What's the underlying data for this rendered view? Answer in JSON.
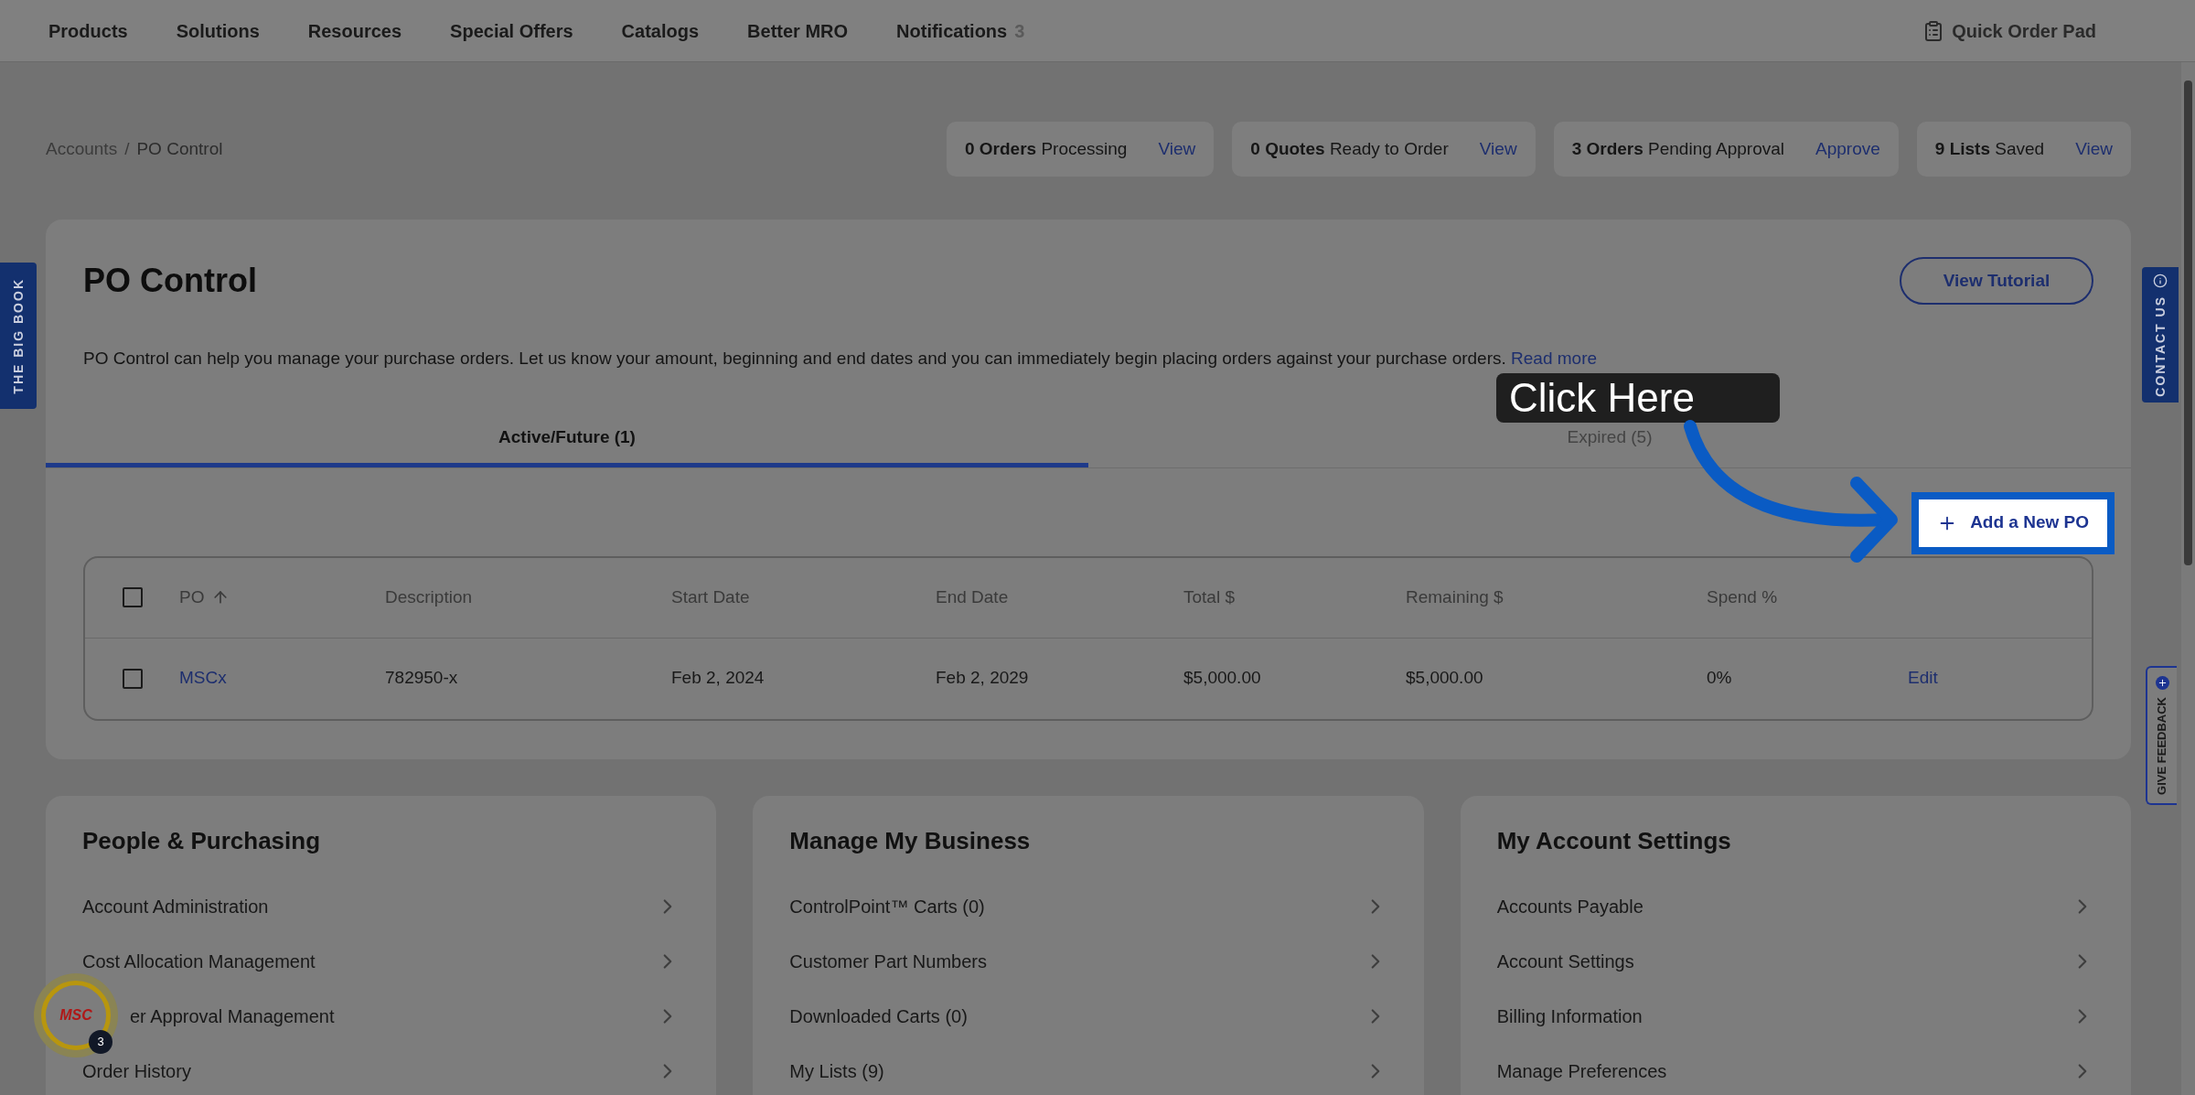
{
  "nav": {
    "items": [
      {
        "label": "Products"
      },
      {
        "label": "Solutions"
      },
      {
        "label": "Resources"
      },
      {
        "label": "Special Offers"
      },
      {
        "label": "Catalogs"
      },
      {
        "label": "Better MRO"
      },
      {
        "label": "Notifications",
        "count": "3"
      }
    ],
    "quick_order": "Quick Order Pad"
  },
  "breadcrumb": {
    "items": [
      "Accounts",
      "PO Control"
    ],
    "separator": "/"
  },
  "stats": [
    {
      "count": "0 Orders",
      "label": "Processing",
      "action": "View"
    },
    {
      "count": "0 Quotes",
      "label": "Ready to Order",
      "action": "View"
    },
    {
      "count": "3 Orders",
      "label": "Pending Approval",
      "action": "Approve"
    },
    {
      "count": "9 Lists",
      "label": "Saved",
      "action": "View"
    }
  ],
  "side_tabs": {
    "left": "THE BIG BOOK",
    "contact": "CONTACT US",
    "feedback": "GIVE FEEDBACK"
  },
  "po": {
    "title": "PO Control",
    "button": "View Tutorial",
    "description": "PO Control can help you manage your purchase orders. Let us know your amount, beginning and end dates and you can immediately begin placing orders against your purchase orders.",
    "read_more": "Read more",
    "tabs": [
      {
        "label": "Active/Future (1)",
        "selected": true
      },
      {
        "label": "Expired (5)",
        "selected": false
      }
    ],
    "add_button": "Add a New PO",
    "table": {
      "select_all_checked": false,
      "columns": [
        "PO",
        "Description",
        "Start Date",
        "End Date",
        "Total $",
        "Remaining $",
        "Spend %"
      ],
      "rows": [
        {
          "checked": false,
          "cells": [
            "MSCx",
            "782950-x",
            "Feb 2, 2024",
            "Feb 2, 2029",
            "$5,000.00",
            "$5,000.00",
            "0%"
          ],
          "action": "Edit"
        }
      ]
    }
  },
  "callout": "Click Here",
  "sections": [
    {
      "title": "People & Purchasing",
      "items": [
        {
          "label": "Account Administration"
        },
        {
          "label": "Cost Allocation Management"
        },
        {
          "label": "er Approval Management",
          "covered": true
        },
        {
          "label": "Order History"
        }
      ]
    },
    {
      "title": "Manage My Business",
      "items": [
        {
          "label": "ControlPoint™ Carts (0)"
        },
        {
          "label": "Customer Part Numbers"
        },
        {
          "label": "Downloaded Carts (0)"
        },
        {
          "label": "My Lists (9)"
        }
      ]
    },
    {
      "title": "My Account Settings",
      "items": [
        {
          "label": "Accounts Payable"
        },
        {
          "label": "Account Settings"
        },
        {
          "label": "Billing Information"
        },
        {
          "label": "Manage Preferences"
        }
      ]
    }
  ],
  "chat_badge": {
    "logo": "MSC",
    "count": "3"
  }
}
